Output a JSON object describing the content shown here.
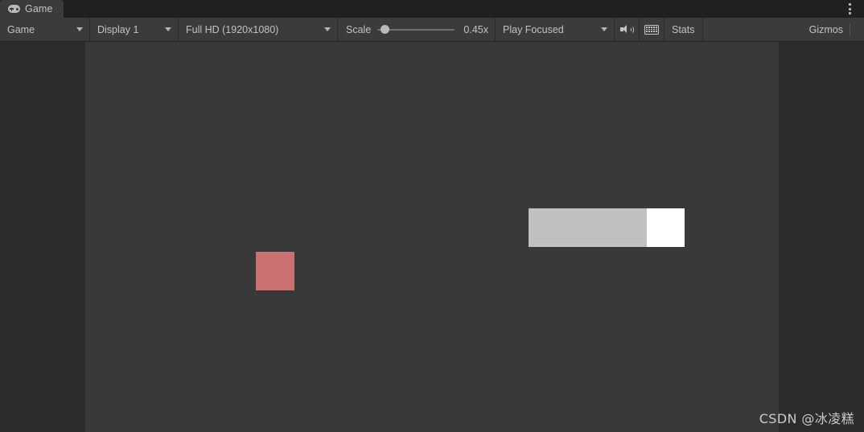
{
  "window": {
    "title": "Game",
    "tab": {
      "label": "Game",
      "icon": "gamepad-icon"
    },
    "menu_icon": "kebab-menu-icon"
  },
  "toolbar": {
    "view_selector": {
      "label": "Game",
      "caret": "chevron-down-icon"
    },
    "display_selector": {
      "label": "Display 1",
      "caret": "chevron-down-icon"
    },
    "resolution_selector": {
      "label": "Full HD (1920x1080)",
      "caret": "chevron-down-icon"
    },
    "scale": {
      "label": "Scale",
      "value": "0.45x",
      "slider_percent": 4
    },
    "play_mode_selector": {
      "label": "Play Focused",
      "caret": "chevron-down-icon"
    },
    "mute_audio": {
      "icon": "speaker-icon"
    },
    "aspect_grid": {
      "icon": "keyboard-grid-icon"
    },
    "stats": {
      "label": "Stats"
    },
    "gizmos": {
      "label": "Gizmos",
      "caret": "chevron-down-icon"
    }
  },
  "game_view": {
    "background_color": "#393939",
    "sprite_square": {
      "name": "red-square-sprite",
      "color": "#c97073"
    },
    "progress_bar": {
      "name": "ui-progress-bar",
      "fill_color": "#c0c0c0",
      "track_color": "#ffffff",
      "fill_percent": 76
    }
  },
  "watermark": {
    "text": "CSDN @冰凌糕"
  }
}
